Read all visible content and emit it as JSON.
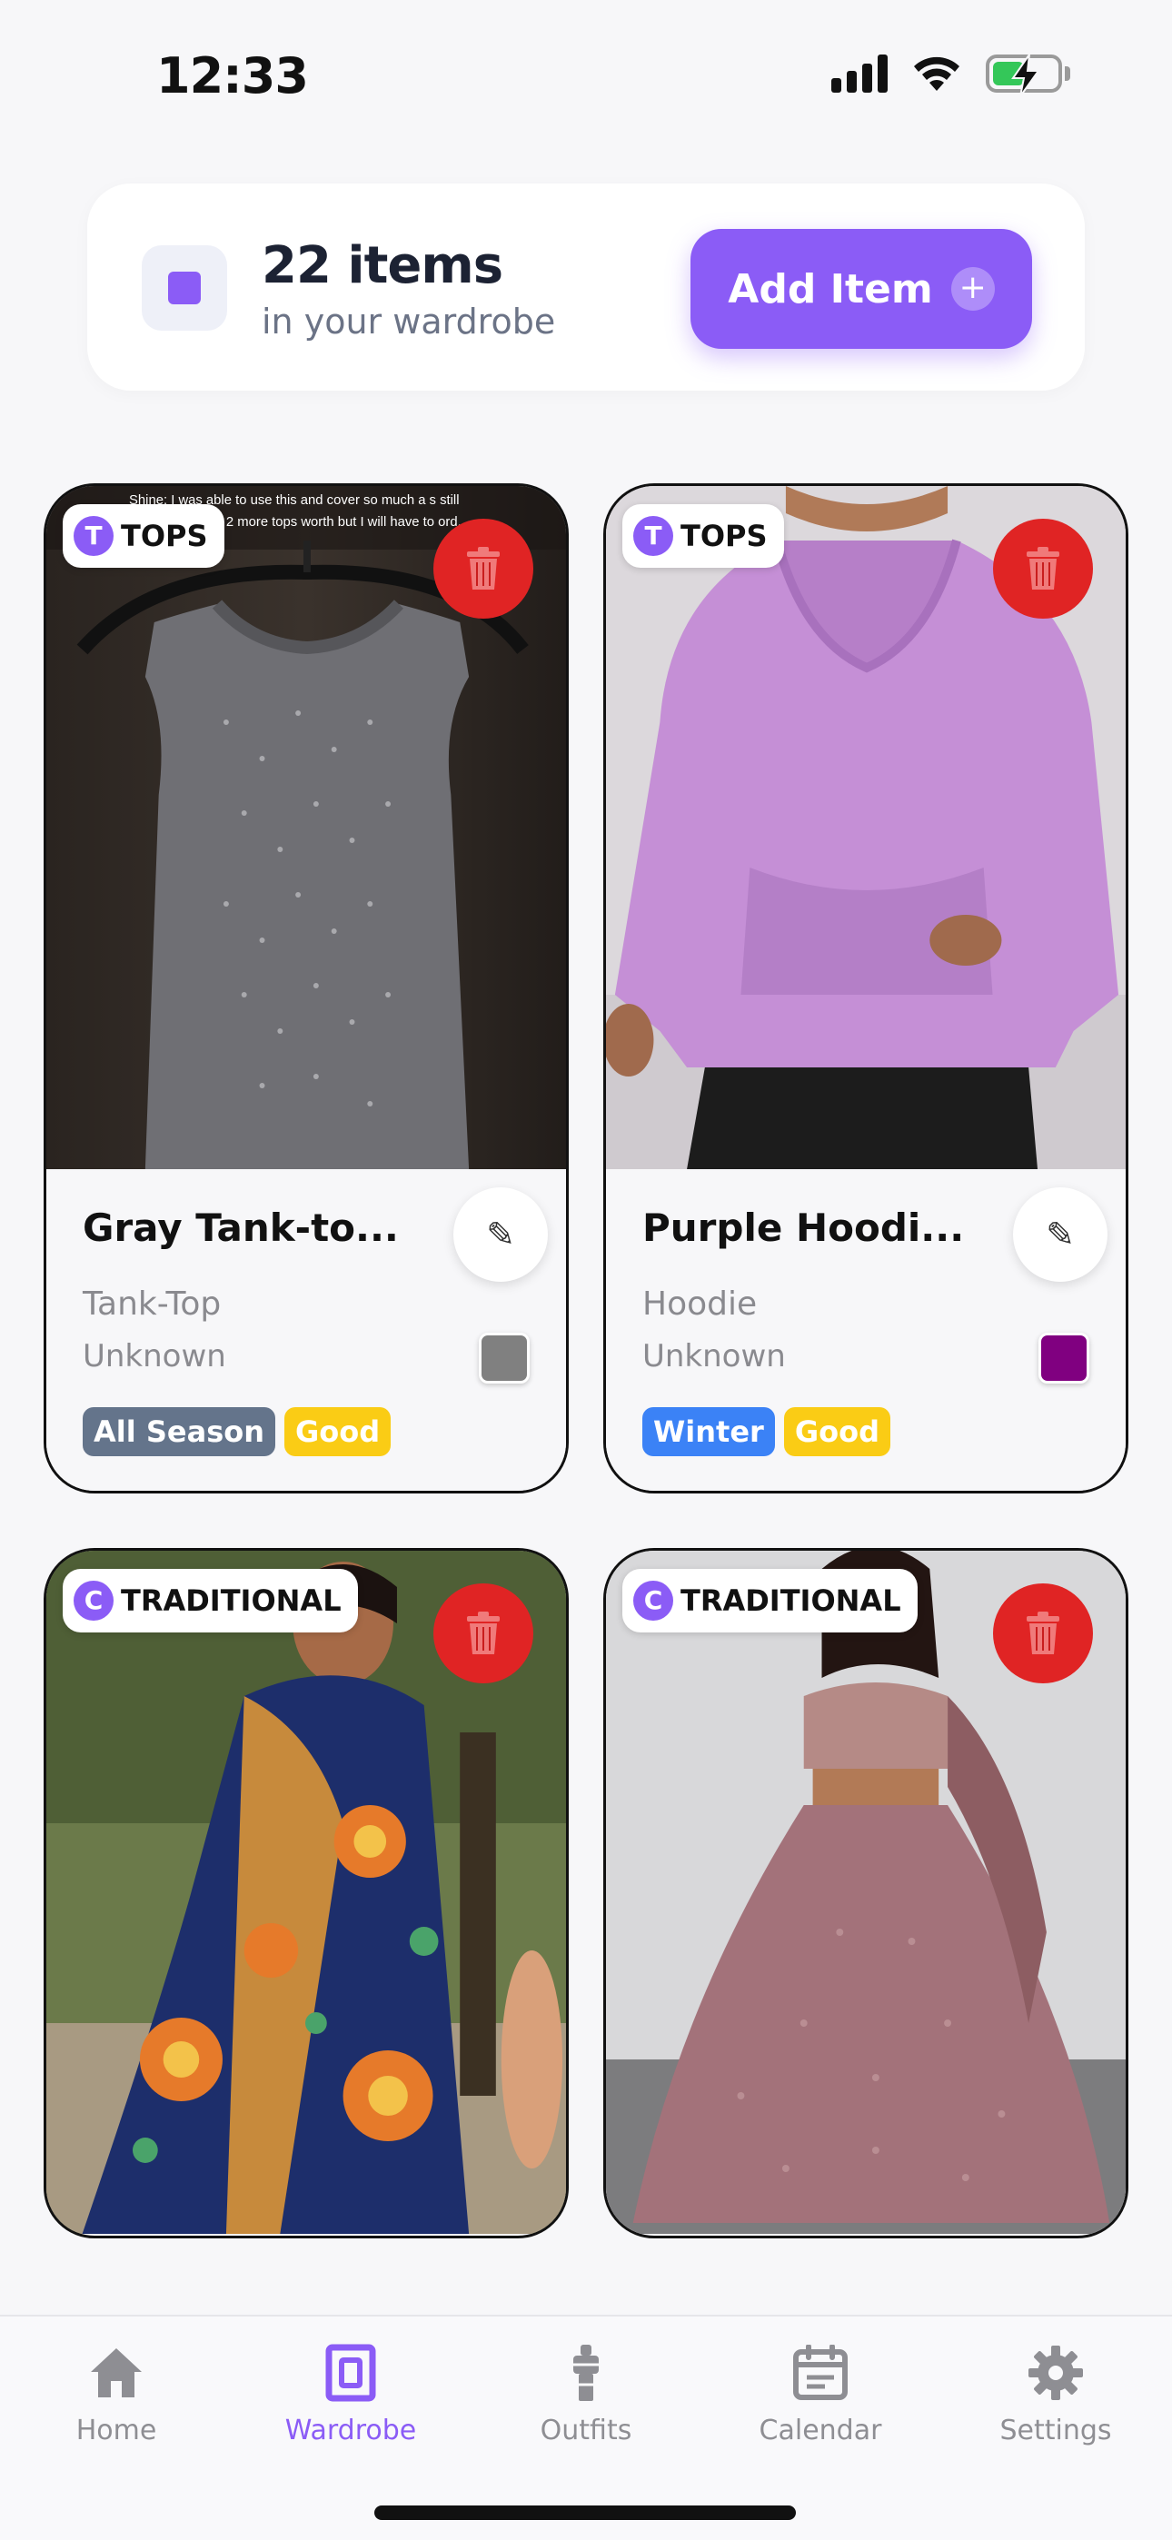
{
  "status_bar": {
    "time": "12:33"
  },
  "header": {
    "count_label": "22 items",
    "subtitle": "in your wardrobe",
    "add_button_label": "Add Item",
    "add_button_icon": "+"
  },
  "colors": {
    "accent": "#8b5cf6",
    "delete": "#e02424",
    "tag_all_season": "#64748b",
    "tag_winter": "#3b82f6",
    "tag_good": "#facc15"
  },
  "items": [
    {
      "category_letter": "T",
      "category": "TOPS",
      "name": "Gray Tank-to...",
      "type": "Tank-Top",
      "brand": "Unknown",
      "color": "#808080",
      "tags": [
        "All Season",
        "Good"
      ],
      "image_caption_line1": "Shine: I was able to use this and cover so much a s still",
      "image_caption_line2": "2 more tops worth but I will have to ord..."
    },
    {
      "category_letter": "T",
      "category": "TOPS",
      "name": "Purple Hoodi...",
      "type": "Hoodie",
      "brand": "Unknown",
      "color": "#800080",
      "tags": [
        "Winter",
        "Good"
      ]
    },
    {
      "category_letter": "C",
      "category": "TRADITIONAL"
    },
    {
      "category_letter": "C",
      "category": "TRADITIONAL"
    }
  ],
  "nav": [
    {
      "label": "Home",
      "icon": "home-icon"
    },
    {
      "label": "Wardrobe",
      "icon": "wardrobe-icon",
      "active": true
    },
    {
      "label": "Outfits",
      "icon": "outfits-icon"
    },
    {
      "label": "Calendar",
      "icon": "calendar-icon"
    },
    {
      "label": "Settings",
      "icon": "gear-icon"
    }
  ]
}
